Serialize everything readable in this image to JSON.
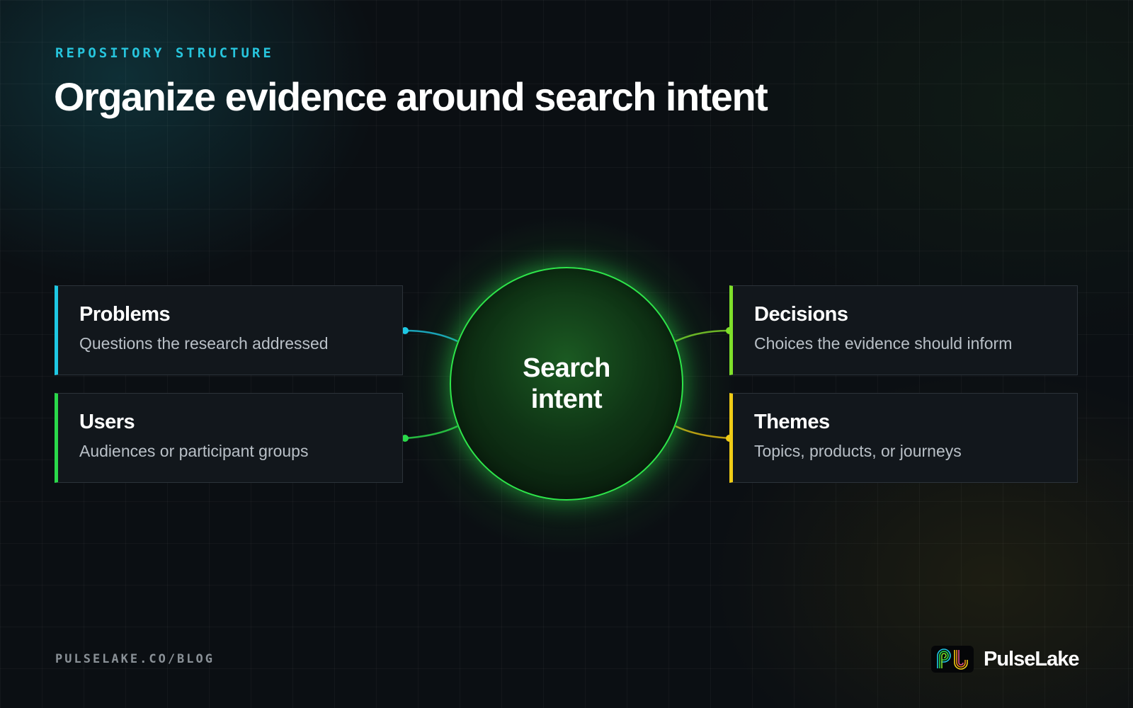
{
  "header": {
    "eyebrow": "REPOSITORY STRUCTURE",
    "title": "Organize evidence around search intent"
  },
  "hub": {
    "label": "Search intent",
    "color": "#2ee54a"
  },
  "cards": [
    {
      "label": "Problems",
      "description": "Questions the research addressed",
      "accent": "#1ec8e4"
    },
    {
      "label": "Users",
      "description": "Audiences or participant groups",
      "accent": "#2ad94a"
    },
    {
      "label": "Decisions",
      "description": "Choices the evidence should inform",
      "accent": "#7fe02a"
    },
    {
      "label": "Themes",
      "description": "Topics, products, or journeys",
      "accent": "#f0cc16"
    }
  ],
  "footer": {
    "url": "PULSELAKE.CO/BLOG",
    "brand": "PulseLake",
    "logo_icon": "pulselake-logo-icon"
  }
}
